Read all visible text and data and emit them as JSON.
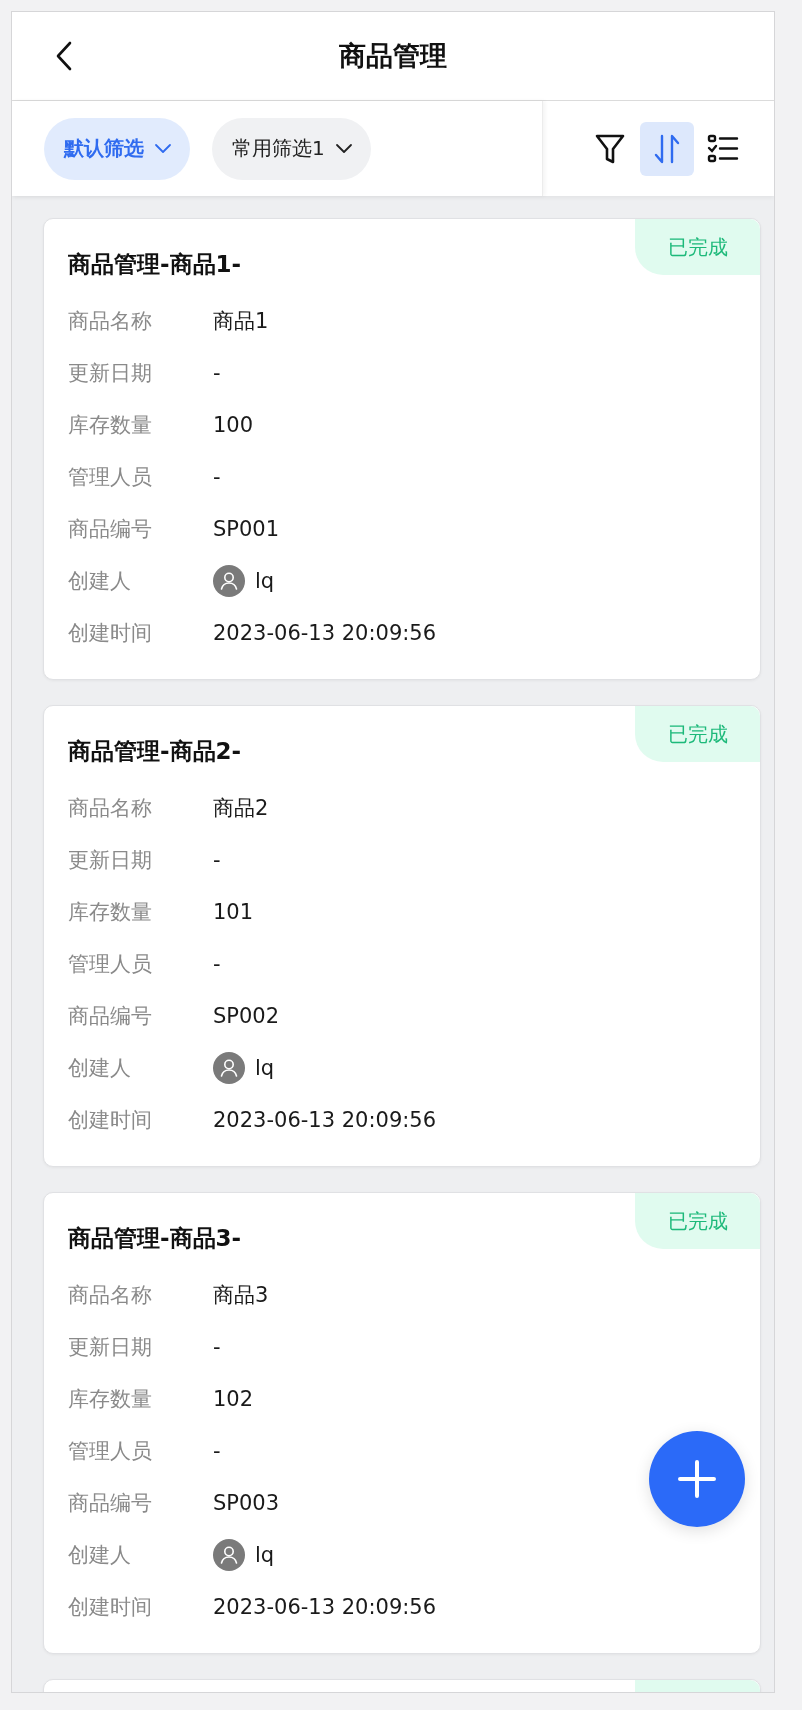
{
  "header": {
    "title": "商品管理"
  },
  "filters": [
    {
      "label": "默认筛选",
      "selected": true
    },
    {
      "label": "常用筛选1",
      "selected": false
    }
  ],
  "tools": [
    {
      "kind": "filter",
      "selected": false
    },
    {
      "kind": "sort",
      "selected": true
    },
    {
      "kind": "columns",
      "selected": false
    }
  ],
  "cards": [
    {
      "kind": "full",
      "title": "商品管理-商品1-",
      "status": "已完成",
      "fields": [
        {
          "label": "商品名称",
          "value": "商品1"
        },
        {
          "label": "更新日期",
          "value": "-"
        },
        {
          "label": "库存数量",
          "value": "100"
        },
        {
          "label": "管理人员",
          "value": "-"
        },
        {
          "label": "商品编号",
          "value": "SP001"
        },
        {
          "label": "创建人",
          "value": "lq",
          "kind": "user"
        },
        {
          "label": "创建时间",
          "value": "2023-06-13 20:09:56"
        }
      ]
    },
    {
      "kind": "full",
      "title": "商品管理-商品2-",
      "status": "已完成",
      "fields": [
        {
          "label": "商品名称",
          "value": "商品2"
        },
        {
          "label": "更新日期",
          "value": "-"
        },
        {
          "label": "库存数量",
          "value": "101"
        },
        {
          "label": "管理人员",
          "value": "-"
        },
        {
          "label": "商品编号",
          "value": "SP002"
        },
        {
          "label": "创建人",
          "value": "lq",
          "kind": "user"
        },
        {
          "label": "创建时间",
          "value": "2023-06-13 20:09:56"
        }
      ]
    },
    {
      "kind": "full",
      "title": "商品管理-商品3-",
      "status": "已完成",
      "fields": [
        {
          "label": "商品名称",
          "value": "商品3"
        },
        {
          "label": "更新日期",
          "value": "-"
        },
        {
          "label": "库存数量",
          "value": "102"
        },
        {
          "label": "管理人员",
          "value": "-"
        },
        {
          "label": "商品编号",
          "value": "SP003"
        },
        {
          "label": "创建人",
          "value": "lq",
          "kind": "user"
        },
        {
          "label": "创建时间",
          "value": "2023-06-13 20:09:56"
        }
      ]
    },
    {
      "kind": "cut"
    }
  ]
}
